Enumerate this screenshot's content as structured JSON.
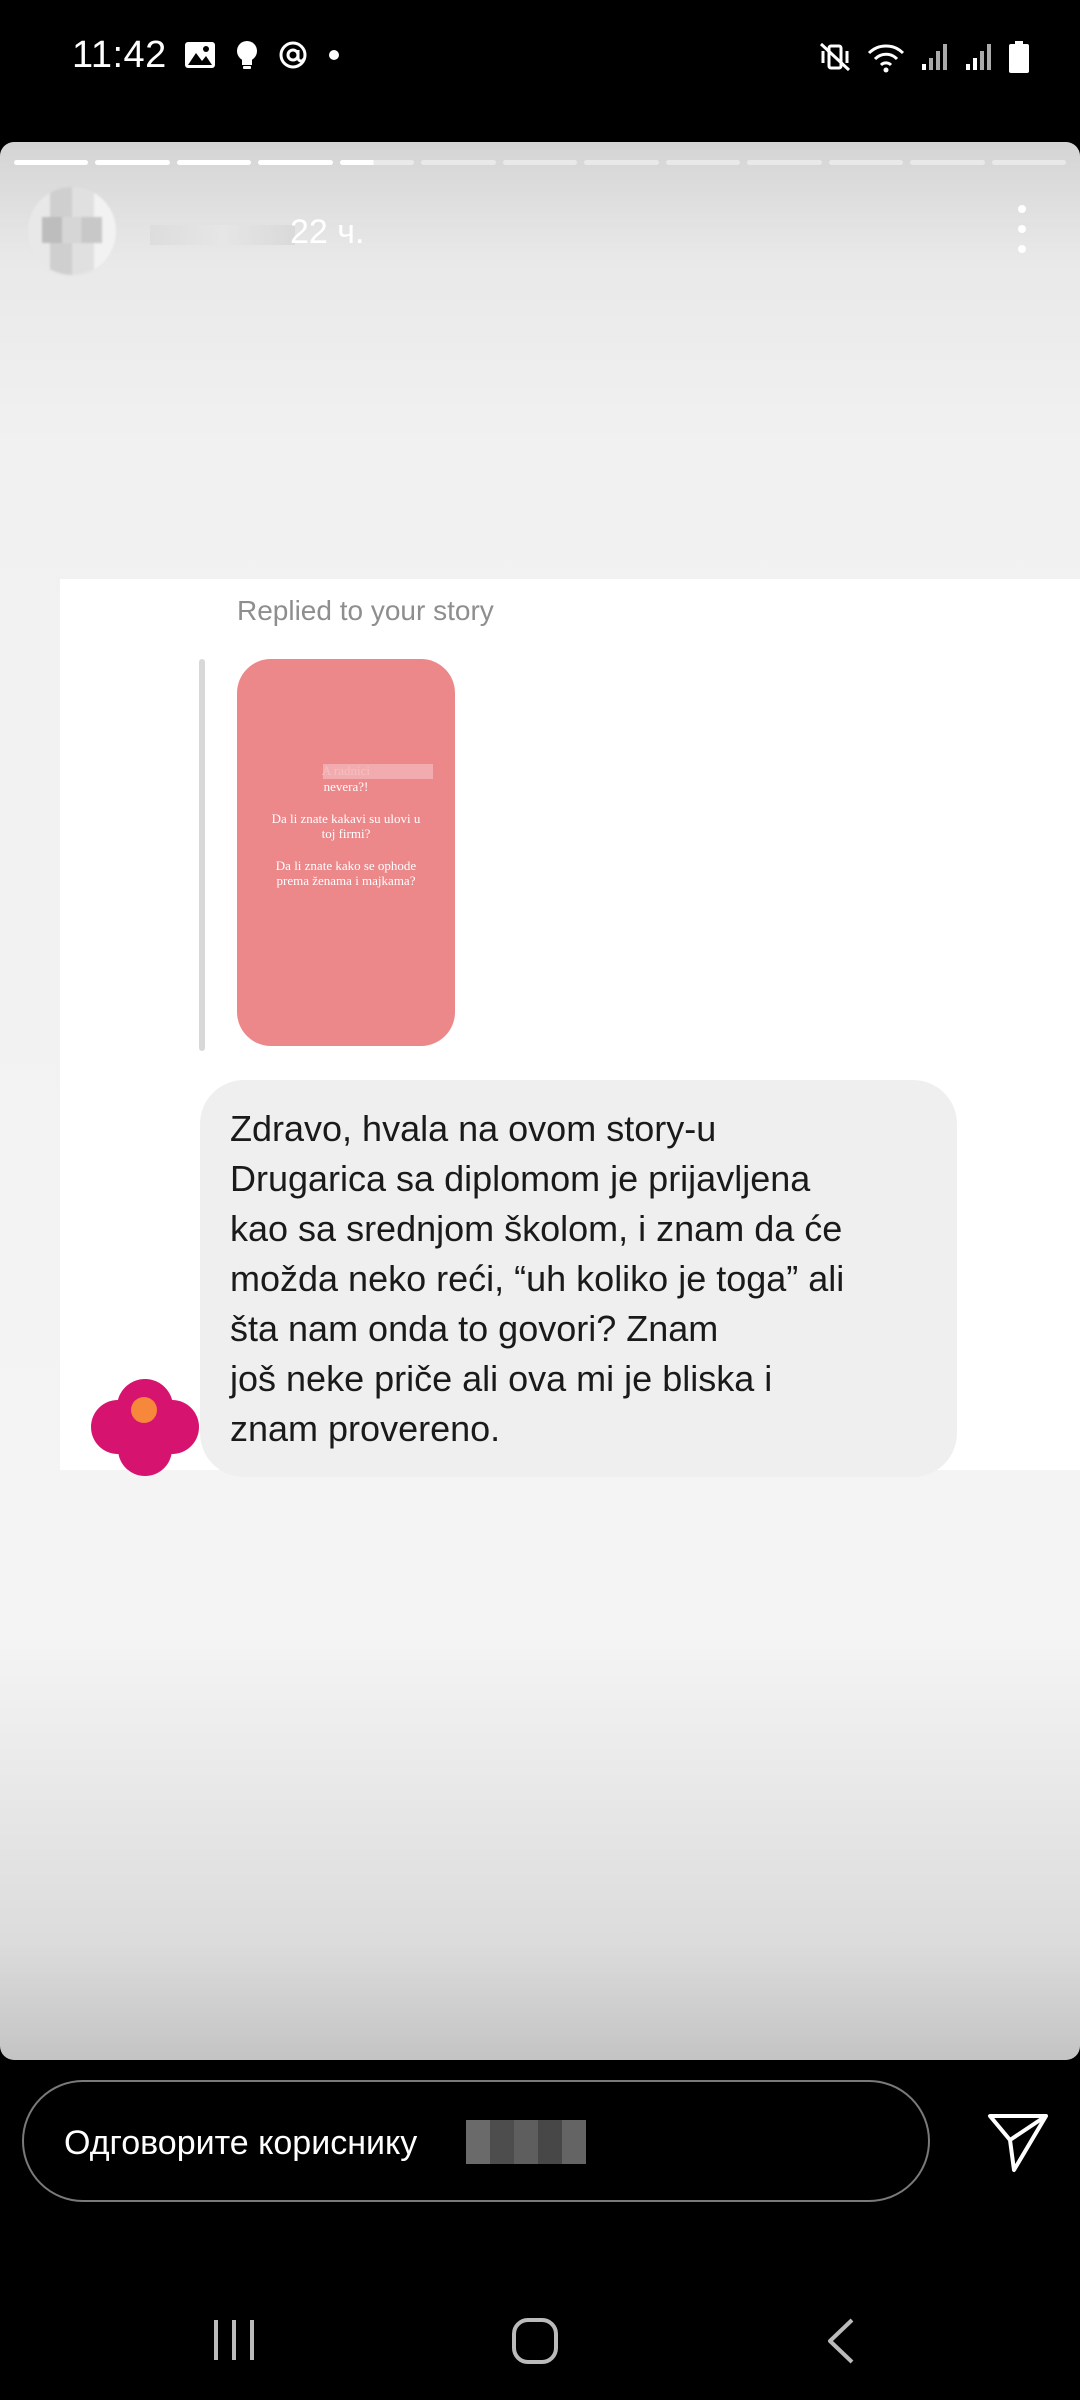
{
  "status_bar": {
    "time": "11:42",
    "left_icons": [
      "image-icon",
      "bulb-icon",
      "threads-icon",
      "dot-icon"
    ],
    "right_icons": [
      "mute-vibrate-icon",
      "wifi-icon",
      "signal-icon",
      "signal-icon",
      "battery-icon"
    ]
  },
  "story": {
    "progress": {
      "total_segments": 13,
      "completed_segments": 4,
      "current_segment_fraction": 0.45
    },
    "header": {
      "time_ago": "22 ч."
    },
    "dm": {
      "replied_label": "Replied to your story",
      "story_thumbnail": {
        "background": "#ec878a",
        "lines": [
          "A radnici",
          "nevera?!",
          "Da li znate kakavi su ulovi u",
          "toj firmi?",
          "Da li znate kako se ophode",
          "prema ženama i majkama?"
        ]
      },
      "message_lines": [
        "Zdravo, hvala na ovom story-u",
        "Drugarica sa diplomom je prijavljena",
        "kao sa srednjom školom, i znam da će",
        "možda neko reći, “uh koliko je toga” ali",
        "šta nam onda to govori? Znam",
        "još neke priče ali ova mi je bliska i",
        "znam provereno."
      ],
      "sender_avatar_colors": {
        "petal": "#d6136f",
        "center": "#f7873a"
      }
    }
  },
  "reply": {
    "placeholder": "Одговорите кориснику"
  },
  "nav": {
    "icons": [
      "recent-apps-icon",
      "home-icon",
      "back-icon"
    ]
  }
}
